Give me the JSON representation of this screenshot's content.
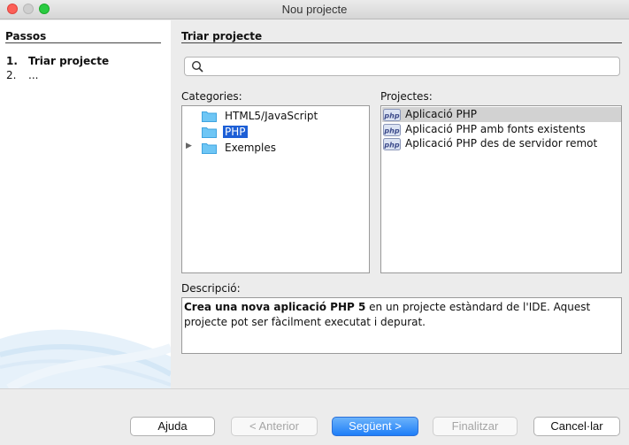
{
  "window": {
    "title": "Nou projecte"
  },
  "steps": {
    "heading": "Passos",
    "items": [
      {
        "number": "1.",
        "label": "Triar projecte"
      },
      {
        "number": "2.",
        "label": "..."
      }
    ]
  },
  "main": {
    "heading": "Triar projecte",
    "search": {
      "value": "",
      "placeholder": ""
    },
    "categories_label": "Categories:",
    "projects_label": "Projectes:",
    "categories": [
      {
        "label": "HTML5/JavaScript",
        "icon": "folder-icon",
        "selected": false
      },
      {
        "label": "PHP",
        "icon": "folder-icon",
        "selected": true
      },
      {
        "label": "Exemples",
        "icon": "folder-icon",
        "selected": false,
        "expandable": true
      }
    ],
    "projects": [
      {
        "label": "Aplicació PHP",
        "icon": "php-icon",
        "selected": true
      },
      {
        "label": "Aplicació PHP amb fonts existents",
        "icon": "php-icon",
        "selected": false
      },
      {
        "label": "Aplicació PHP des de servidor remot",
        "icon": "php-icon",
        "selected": false
      }
    ],
    "description_label": "Descripció:",
    "description": {
      "bold": "Crea una nova aplicació PHP 5",
      "rest": " en un projecte estàndard de l'IDE. Aquest projecte pot ser fàcilment executat i depurat."
    }
  },
  "buttons": {
    "help": "Ajuda",
    "back": "< Anterior",
    "next": "Següent >",
    "finish": "Finalitzar",
    "cancel": "Cancel·lar"
  },
  "colors": {
    "selection_blue": "#1d5fd6",
    "primary_button": "#1e7ef8",
    "folder": "#6ec6f5"
  }
}
